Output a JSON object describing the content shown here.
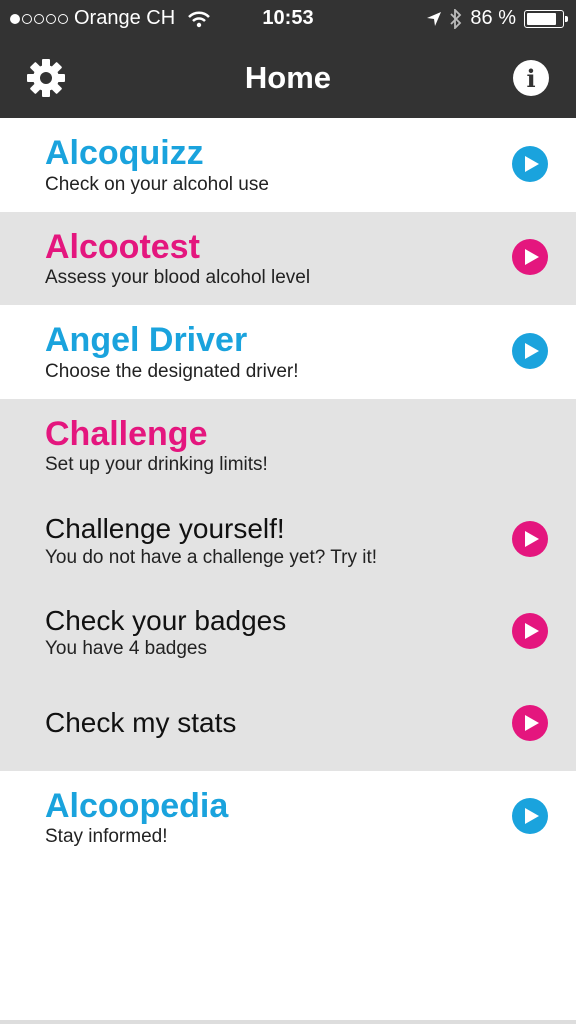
{
  "status_bar": {
    "carrier": "Orange CH",
    "time": "10:53",
    "battery_percent": "86 %",
    "battery_level": 0.86
  },
  "nav": {
    "title": "Home"
  },
  "colors": {
    "blue": "#1aa3dd",
    "pink": "#e4167e",
    "header_bg": "#333333",
    "grey_row": "#e3e3e3"
  },
  "menu": {
    "alcoquizz": {
      "title": "Alcoquizz",
      "subtitle": "Check on your alcohol use",
      "icon": "play-icon"
    },
    "alcootest": {
      "title": "Alcootest",
      "subtitle": "Assess your blood alcohol level",
      "icon": "play-icon"
    },
    "angel_driver": {
      "title": "Angel Driver",
      "subtitle": "Choose the designated driver!",
      "icon": "play-icon"
    },
    "challenge": {
      "title": "Challenge",
      "subtitle": "Set up your drinking limits!",
      "items": [
        {
          "title": "Challenge yourself!",
          "subtitle": "You do not have a challenge yet? Try it!"
        },
        {
          "title": "Check your badges",
          "subtitle": "You have 4 badges"
        },
        {
          "title": "Check my stats",
          "subtitle": ""
        }
      ]
    },
    "alcoopedia": {
      "title": "Alcoopedia",
      "subtitle": "Stay informed!",
      "icon": "play-icon"
    }
  }
}
